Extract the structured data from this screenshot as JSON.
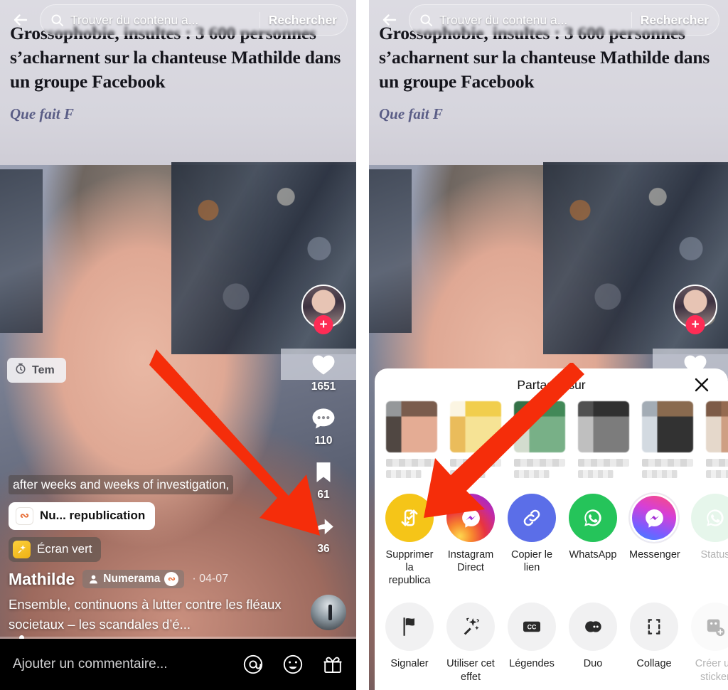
{
  "search": {
    "placeholder": "Trouver du contenu a...",
    "button": "Rechercher",
    "back_icon": "back-arrow-icon",
    "search_icon": "search-icon"
  },
  "article": {
    "title": "Grossophobie, insultes : 3 600 personnes s’acharnent sur la chanteuse Mathilde dans un groupe Facebook",
    "subtitle": "Que fait F"
  },
  "video": {
    "timer_chip": "Tem",
    "timer_icon": "stopwatch-icon",
    "subtitle_line": "after weeks and weeks of investigation,",
    "repost_chip": "Nu... republication",
    "repost_icon": "numerama-logo-icon",
    "effect_chip": "Écran vert",
    "effect_icon": "green-screen-icon",
    "author": "Mathilde",
    "brand_tag": "Numerama",
    "brand_icon": "numerama-badge-icon",
    "date": "· 04-07",
    "caption": "Ensemble, continuons à lutter contre les fléaux societaux – les scandales d’é...",
    "music_icon": "music-disc-icon"
  },
  "rail": {
    "avatar": "creator-avatar",
    "follow": "+",
    "items": [
      {
        "icon": "heart-icon",
        "count": "1651",
        "name": "like-button"
      },
      {
        "icon": "comment-icon",
        "count": "110",
        "name": "comment-button"
      },
      {
        "icon": "bookmark-icon",
        "count": "61",
        "name": "bookmark-button"
      },
      {
        "icon": "share-arrow-icon",
        "count": "36",
        "name": "share-button"
      }
    ]
  },
  "comment_bar": {
    "placeholder": "Ajouter un commentaire...",
    "icons": [
      "at-icon",
      "emoji-icon",
      "gift-icon"
    ]
  },
  "share_sheet": {
    "title": "Partager sur",
    "close_icon": "close-icon",
    "contacts": [
      {
        "name": "contact-avatar-1",
        "colors": [
          "#6c4b3a",
          "#e2a489",
          "#3d342e",
          "#8a8d8f"
        ]
      },
      {
        "name": "contact-avatar-2",
        "colors": [
          "#f0c93a",
          "#f6e08a",
          "#e8b54a",
          "#fbf4df"
        ]
      },
      {
        "name": "contact-avatar-3",
        "colors": [
          "#2e7d46",
          "#6aa87a",
          "#cfd9c9",
          "#1f6234"
        ]
      },
      {
        "name": "contact-avatar-4",
        "colors": [
          "#1a1a1a",
          "#6e6e6e",
          "#b9b9b9",
          "#3d3d3d"
        ]
      },
      {
        "name": "contact-avatar-5",
        "colors": [
          "#7d5a3c",
          "#1c1c1c",
          "#cfd6de",
          "#9aa3ad"
        ]
      },
      {
        "name": "contact-avatar-6",
        "colors": [
          "#8a5a3d",
          "#c99576",
          "#e3d4c6",
          "#6f4a33"
        ]
      }
    ],
    "apps": [
      {
        "label": "Supprimer la republica",
        "icon": "repost-icon",
        "name": "action-remove-repost",
        "bg": "#f5c518",
        "dim": false
      },
      {
        "label": "Instagram Direct",
        "icon": "instagram-direct-icon",
        "name": "action-instagram-direct",
        "bg": "instagram",
        "dim": false
      },
      {
        "label": "Copier le lien",
        "icon": "link-icon",
        "name": "action-copy-link",
        "bg": "#5b6ee8",
        "dim": false
      },
      {
        "label": "WhatsApp",
        "icon": "whatsapp-icon",
        "name": "action-whatsapp",
        "bg": "#25c45a",
        "dim": false
      },
      {
        "label": "Messenger",
        "icon": "messenger-icon",
        "name": "action-messenger",
        "bg": "messenger",
        "dim": false
      },
      {
        "label": "Status",
        "icon": "whatsapp-status-icon",
        "name": "action-whatsapp-status",
        "bg": "#b9e8c8",
        "dim": true
      }
    ],
    "tools": [
      {
        "label": "Signaler",
        "icon": "flag-icon",
        "name": "action-report",
        "dim": false
      },
      {
        "label": "Utiliser cet effet",
        "icon": "magic-wand-icon",
        "name": "action-use-effect",
        "dim": false
      },
      {
        "label": "Légendes",
        "icon": "closed-captions-icon",
        "name": "action-captions",
        "dim": false
      },
      {
        "label": "Duo",
        "icon": "duet-icon",
        "name": "action-duet",
        "dim": false
      },
      {
        "label": "Collage",
        "icon": "stitch-icon",
        "name": "action-stitch",
        "dim": false
      },
      {
        "label": "Créer un sticker",
        "icon": "create-sticker-icon",
        "name": "action-create-sticker",
        "dim": true
      }
    ]
  },
  "annotations": {
    "arrow_color": "#f52d0a",
    "left_arrow": "arrow-pointing-to-share-button",
    "right_arrow": "arrow-pointing-to-repost-action"
  }
}
